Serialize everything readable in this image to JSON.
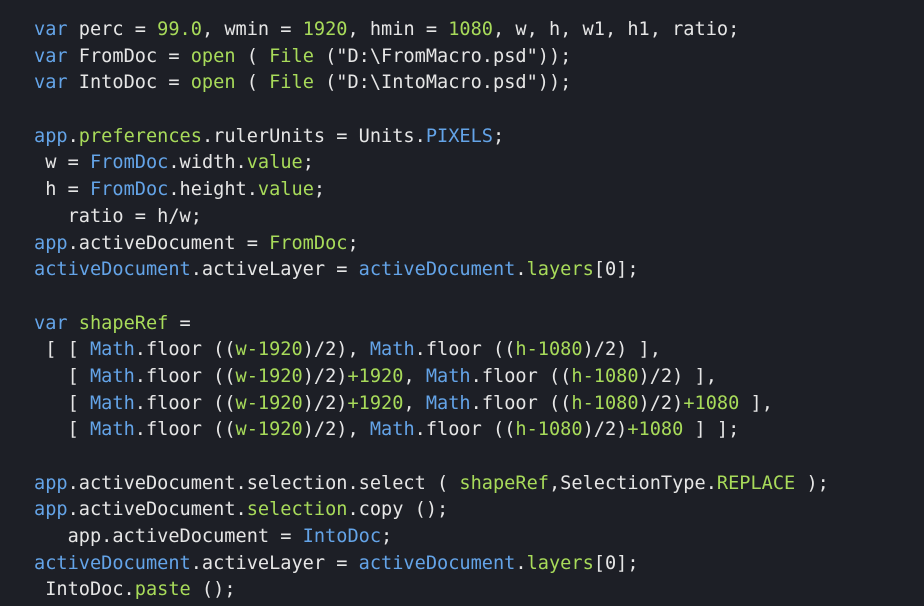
{
  "colors": {
    "background": "#1d1f26",
    "plain": "#e6e6e6",
    "keyword": "#64a4e8",
    "green": "#a8db5a",
    "blue": "#64a4e8"
  },
  "code_lines": [
    [
      [
        "keyword",
        "var"
      ],
      [
        "plain",
        " perc = "
      ],
      [
        "green",
        "99.0"
      ],
      [
        "plain",
        ", wmin = "
      ],
      [
        "green",
        "1920"
      ],
      [
        "plain",
        ", hmin = "
      ],
      [
        "green",
        "1080"
      ],
      [
        "plain",
        ", w, h, w1, h1, ratio;"
      ]
    ],
    [
      [
        "keyword",
        "var"
      ],
      [
        "plain",
        " FromDoc = "
      ],
      [
        "green",
        "open"
      ],
      [
        "plain",
        " ( "
      ],
      [
        "green",
        "File"
      ],
      [
        "plain",
        " (\"D:\\FromMacro.psd\"));"
      ]
    ],
    [
      [
        "keyword",
        "var"
      ],
      [
        "plain",
        " IntoDoc = "
      ],
      [
        "green",
        "open"
      ],
      [
        "plain",
        " ( "
      ],
      [
        "green",
        "File"
      ],
      [
        "plain",
        " (\"D:\\IntoMacro.psd\"));"
      ]
    ],
    [],
    [
      [
        "blue",
        "app"
      ],
      [
        "plain",
        "."
      ],
      [
        "green",
        "preferences"
      ],
      [
        "plain",
        ".rulerUnits = Units."
      ],
      [
        "blue",
        "PIXELS"
      ],
      [
        "plain",
        ";"
      ]
    ],
    [
      [
        "plain",
        " w = "
      ],
      [
        "blue",
        "FromDoc"
      ],
      [
        "plain",
        ".width."
      ],
      [
        "green",
        "value"
      ],
      [
        "plain",
        ";"
      ]
    ],
    [
      [
        "plain",
        " h = "
      ],
      [
        "blue",
        "FromDoc"
      ],
      [
        "plain",
        ".height."
      ],
      [
        "green",
        "value"
      ],
      [
        "plain",
        ";"
      ]
    ],
    [
      [
        "plain",
        "   ratio = h/w;"
      ]
    ],
    [
      [
        "blue",
        "app"
      ],
      [
        "plain",
        ".activeDocument = "
      ],
      [
        "green",
        "FromDoc"
      ],
      [
        "plain",
        ";"
      ]
    ],
    [
      [
        "blue",
        "activeDocument"
      ],
      [
        "plain",
        ".activeLayer = "
      ],
      [
        "blue",
        "activeDocument"
      ],
      [
        "plain",
        "."
      ],
      [
        "green",
        "layers"
      ],
      [
        "plain",
        "[0];"
      ]
    ],
    [],
    [
      [
        "keyword",
        "var"
      ],
      [
        "plain",
        " "
      ],
      [
        "green",
        "shapeRef"
      ],
      [
        "plain",
        " ="
      ]
    ],
    [
      [
        "plain",
        " [ [ "
      ],
      [
        "blue",
        "Math"
      ],
      [
        "plain",
        ".floor (("
      ],
      [
        "green",
        "w-1920"
      ],
      [
        "plain",
        ")/2), "
      ],
      [
        "blue",
        "Math"
      ],
      [
        "plain",
        ".floor (("
      ],
      [
        "green",
        "h-1080"
      ],
      [
        "plain",
        ")/2) ],"
      ]
    ],
    [
      [
        "plain",
        "   [ "
      ],
      [
        "blue",
        "Math"
      ],
      [
        "plain",
        ".floor (("
      ],
      [
        "green",
        "w-1920"
      ],
      [
        "plain",
        ")/2)"
      ],
      [
        "green",
        "+1920"
      ],
      [
        "plain",
        ", "
      ],
      [
        "blue",
        "Math"
      ],
      [
        "plain",
        ".floor (("
      ],
      [
        "green",
        "h-1080"
      ],
      [
        "plain",
        ")/2) ],"
      ]
    ],
    [
      [
        "plain",
        "   [ "
      ],
      [
        "blue",
        "Math"
      ],
      [
        "plain",
        ".floor (("
      ],
      [
        "green",
        "w-1920"
      ],
      [
        "plain",
        ")/2)"
      ],
      [
        "green",
        "+1920"
      ],
      [
        "plain",
        ", "
      ],
      [
        "blue",
        "Math"
      ],
      [
        "plain",
        ".floor (("
      ],
      [
        "green",
        "h-1080"
      ],
      [
        "plain",
        ")/2)"
      ],
      [
        "green",
        "+1080"
      ],
      [
        "plain",
        " ],"
      ]
    ],
    [
      [
        "plain",
        "   [ "
      ],
      [
        "blue",
        "Math"
      ],
      [
        "plain",
        ".floor (("
      ],
      [
        "green",
        "w-1920"
      ],
      [
        "plain",
        ")/2), "
      ],
      [
        "blue",
        "Math"
      ],
      [
        "plain",
        ".floor (("
      ],
      [
        "green",
        "h-1080"
      ],
      [
        "plain",
        ")/2)"
      ],
      [
        "green",
        "+1080"
      ],
      [
        "plain",
        " ] ];"
      ]
    ],
    [],
    [
      [
        "blue",
        "app"
      ],
      [
        "plain",
        ".activeDocument.selection.select ( "
      ],
      [
        "green",
        "shapeRef"
      ],
      [
        "plain",
        ",SelectionType."
      ],
      [
        "green",
        "REPLACE"
      ],
      [
        "plain",
        " );"
      ]
    ],
    [
      [
        "blue",
        "app"
      ],
      [
        "plain",
        ".activeDocument."
      ],
      [
        "green",
        "selection"
      ],
      [
        "plain",
        ".copy ();"
      ]
    ],
    [
      [
        "plain",
        "   app.activeDocument = "
      ],
      [
        "blue",
        "IntoDoc"
      ],
      [
        "plain",
        ";"
      ]
    ],
    [
      [
        "blue",
        "activeDocument"
      ],
      [
        "plain",
        ".activeLayer = "
      ],
      [
        "blue",
        "activeDocument"
      ],
      [
        "plain",
        "."
      ],
      [
        "green",
        "layers"
      ],
      [
        "plain",
        "[0];"
      ]
    ],
    [
      [
        "plain",
        " IntoDoc."
      ],
      [
        "green",
        "paste"
      ],
      [
        "plain",
        " ();"
      ]
    ]
  ]
}
